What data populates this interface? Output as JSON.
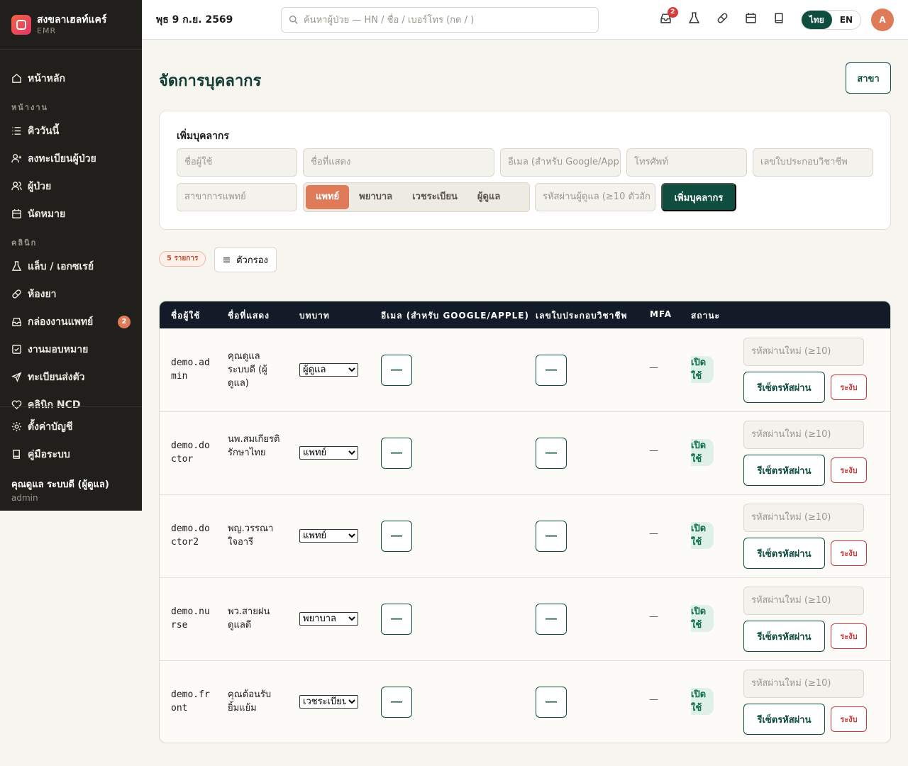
{
  "app": {
    "name": "สงขลาเฮลท์แคร์",
    "sub": "EMR"
  },
  "sidebar": {
    "home": "หน้าหลัก",
    "section_work": "หน้างาน",
    "work_items": [
      "คิววันนี้",
      "ลงทะเบียนผู้ป่วย",
      "ผู้ป่วย",
      "นัดหมาย"
    ],
    "section_clinic": "คลินิก",
    "clinic_items": [
      "แล็บ / เอกซเรย์",
      "ห้องยา",
      "กล่องงานแพทย์",
      "งานมอบหมาย",
      "ทะเบียนส่งตัว",
      "คลินิก NCD"
    ],
    "doctor_inbox_badge": "2",
    "footer_items": [
      "ตั้งค่าบัญชี",
      "คู่มือระบบ"
    ],
    "user_name": "คุณดูแล ระบบดี (ผู้ดูแล)",
    "user_role": "admin"
  },
  "topbar": {
    "date": "พุธ 9 ก.ย. 2569",
    "search_placeholder": "ค้นหาผู้ป่วย — HN / ชื่อ / เบอร์โทร (กด / )",
    "inbox_badge": "2",
    "lang_th": "ไทย",
    "lang_en": "EN",
    "avatar_initial": "A"
  },
  "page": {
    "title": "จัดการบุคลากร",
    "branch_button": "สาขา"
  },
  "add_form": {
    "title": "เพิ่มบุคลากร",
    "username_placeholder": "ชื่อผู้ใช้",
    "display_placeholder": "ชื่อที่แสดง",
    "email_placeholder": "อีเมล (สำหรับ Google/App",
    "phone_placeholder": "โทรศัพท์",
    "license_placeholder": "เลขใบประกอบวิชาชีพ",
    "specialty_placeholder": "สาขาการแพทย์",
    "roles": [
      "แพทย์",
      "พยาบาล",
      "เวชระเบียน",
      "ผู้ดูแล"
    ],
    "selected_role": "แพทย์",
    "password_placeholder": "รหัสผ่านผู้ดูแล (≥10 ตัวอัก",
    "submit_label": "เพิ่มบุคลากร"
  },
  "list": {
    "count_label": "5 รายการ",
    "filter_label": "ตัวกรอง"
  },
  "table": {
    "headers": [
      "ชื่อผู้ใช้",
      "ชื่อที่แสดง",
      "บทบาท",
      "อีเมล (สำหรับ GOOGLE/APPLE)",
      "เลขใบประกอบวิชาชีพ",
      "MFA",
      "สถานะ"
    ],
    "rows": [
      {
        "username": "demo.admin",
        "display": "คุณดูแล ระบบดี (ผู้ดูแล)",
        "role": "ผู้ดูแล",
        "email": "—",
        "license": "—",
        "mfa": "—",
        "status": "เปิดใช้"
      },
      {
        "username": "demo.doctor",
        "display": "นพ.สมเกียรติ รักษาไทย",
        "role": "แพทย์",
        "email": "—",
        "license": "—",
        "mfa": "—",
        "status": "เปิดใช้"
      },
      {
        "username": "demo.doctor2",
        "display": "พญ.วรรณา ใจอารี",
        "role": "แพทย์",
        "email": "—",
        "license": "—",
        "mfa": "—",
        "status": "เปิดใช้"
      },
      {
        "username": "demo.nurse",
        "display": "พว.สายฝน ดูแลดี",
        "role": "พยาบาล",
        "email": "—",
        "license": "—",
        "mfa": "—",
        "status": "เปิดใช้"
      },
      {
        "username": "demo.front",
        "display": "คุณต้อนรับ ยิ้มแย้ม",
        "role": "เวชระเบียน",
        "email": "—",
        "license": "—",
        "mfa": "—",
        "status": "เปิดใช้"
      }
    ],
    "role_options": [
      "แพทย์",
      "พยาบาล",
      "เวชระเบียน",
      "ผู้ดูแล"
    ],
    "new_password_placeholder": "รหัสผ่านใหม่ (≥10)",
    "reset_label": "รีเซ็ตรหัสผ่าน",
    "suspend_label": "ระงับ"
  },
  "colors": {
    "primary": "#0f4d3f",
    "accent": "#e07b5a",
    "sidebar_bg": "#211f1c",
    "table_header_bg": "#121b27",
    "danger": "#c83a3a"
  }
}
